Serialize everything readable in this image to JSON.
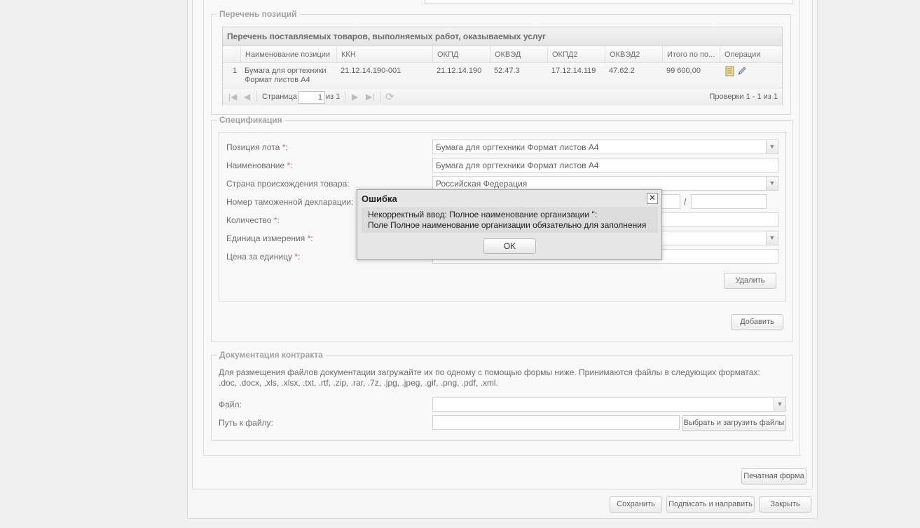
{
  "positions_section": {
    "legend": "Перечень позиций",
    "grid_title": "Перечень поставляемых товаров, выполняемых работ, оказываемых услуг",
    "columns": [
      "Наименование позиции",
      "ККН",
      "ОКПД",
      "ОКВЭД",
      "ОКПД2",
      "ОКВЭД2",
      "Итого по по...",
      "Операции"
    ],
    "rows": [
      {
        "num": "1",
        "name": "Бумага для оргтехники Формат листов А4",
        "kkn": "21.12.14.190-001",
        "okpd": "21.12.14.190",
        "okved": "52.47.3",
        "okpd2": "17.12.14.119",
        "okved2": "47.62.2",
        "total": "99 600,00"
      }
    ],
    "pager": {
      "page_label": "Страница",
      "page_value": "1",
      "of_label": "из 1",
      "summary": "Проверки 1 - 1 из 1"
    }
  },
  "specification": {
    "legend": "Спецификация",
    "lot_position_label": "Позиция лота",
    "lot_position_value": "Бумага для оргтехники Формат листов А4",
    "name_label": "Наименование",
    "name_value": "Бумага для оргтехники Формат листов А4",
    "country_label": "Страна происхождения товара:",
    "country_value": "Российская Федерация",
    "customs_label": "Номер таможенной декларации:",
    "customs_sep": "/",
    "quantity_label": "Количество",
    "unit_label": "Единица измерения",
    "price_label": "Цена за единицу",
    "required_mark": "*",
    "colon": ":",
    "delete_button": "Удалить",
    "add_button": "Добавить"
  },
  "documentation": {
    "legend": "Документация контракта",
    "info_line1": "Для размещения файлов документации загружайте их по одному с помощью формы ниже. Принимаются файлы в следующих форматах:",
    "info_line2": ".doc, .docx, .xls, .xlsx, .txt, .rtf, .zip, .rar, .7z, .jpg, .jpeg, .gif, .png, .pdf, .xml.",
    "file_label": "Файл:",
    "path_label": "Путь к файлу:",
    "upload_button": "Выбрать и загрузить файлы"
  },
  "footer": {
    "print_button": "Печатная форма",
    "save_button": "Сохранить",
    "sign_button": "Подписать и направить",
    "close_button": "Закрыть"
  },
  "dialog": {
    "title": "Ошибка",
    "message_line1": "Некорректный ввод: Полное наименование организации '':",
    "message_line2": "Поле Полное наименование организации обязательно для заполнения",
    "ok_button": "OK"
  },
  "colors": {
    "required": "#e23030",
    "page_background": "#ececec"
  },
  "icons": {
    "operations_view": "document-icon",
    "operations_edit": "pencil-icon"
  }
}
